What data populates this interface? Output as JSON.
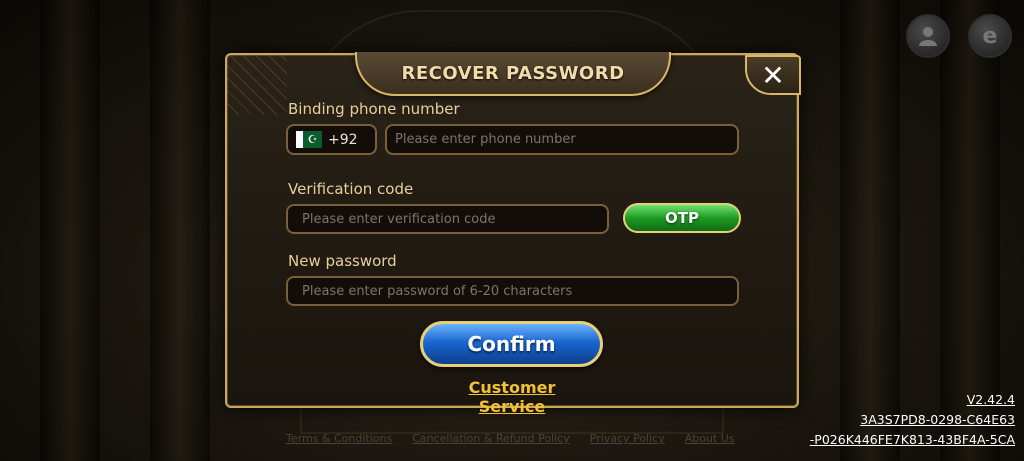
{
  "dialog": {
    "title": "RECOVER PASSWORD",
    "close_symbol": "✕"
  },
  "phone": {
    "label": "Binding phone number",
    "country_code": "+92",
    "country_flag": "pakistan-flag-icon",
    "placeholder": "Please enter phone number"
  },
  "verification": {
    "label": "Verification code",
    "placeholder": "Please enter verification code",
    "otp_label": "OTP"
  },
  "password": {
    "label": "New password",
    "placeholder": "Please enter password of 6-20 characters"
  },
  "confirm_label": "Confirm",
  "customer_service_label": "Customer Service",
  "footer": {
    "links": [
      "Terms & Conditions",
      "Cancellation & Refund Policy",
      "Privacy Policy",
      "About Us"
    ]
  },
  "version": {
    "number": "V2.42.4",
    "id_line1": "3A3S7PD8-0298-C64E63",
    "id_line2": "-P026K446FE7K813-43BF4A-5CA"
  },
  "top_icons": [
    "profile-icon",
    "browser-e-icon"
  ],
  "colors": {
    "gold_border": "#c9a860",
    "otp_green": "#1f9a24",
    "confirm_blue": "#1b66cf",
    "link_yellow": "#f2c233"
  }
}
